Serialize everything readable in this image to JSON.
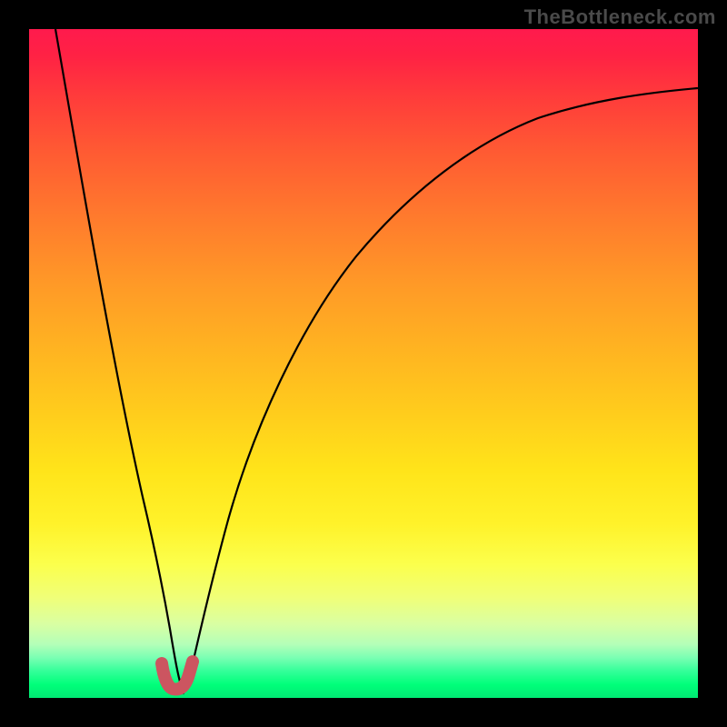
{
  "watermark": "TheBottleneck.com",
  "chart_data": {
    "type": "line",
    "title": "",
    "xlabel": "",
    "ylabel": "",
    "xlim": [
      0,
      100
    ],
    "ylim": [
      0,
      100
    ],
    "series": [
      {
        "name": "curve",
        "x": [
          4,
          6,
          8,
          10,
          12,
          14,
          16,
          17,
          18,
          19,
          20,
          21,
          22,
          23,
          24,
          25,
          27,
          30,
          35,
          40,
          45,
          50,
          55,
          60,
          65,
          70,
          75,
          80,
          85,
          90,
          95,
          100
        ],
        "values": [
          100,
          87,
          75,
          63,
          50,
          37,
          24,
          17,
          10,
          5,
          2,
          0.5,
          0.3,
          0.5,
          2,
          5,
          12,
          22,
          35,
          46,
          55,
          62,
          68,
          73,
          77,
          80,
          82.5,
          84.5,
          86,
          87,
          87.8,
          88.5
        ]
      },
      {
        "name": "highlight",
        "x": [
          19.5,
          20,
          20.5,
          21,
          21.5,
          22,
          22.5,
          23,
          23.5
        ],
        "values": [
          4,
          2,
          1,
          0.5,
          0.5,
          1,
          2,
          3.5,
          5
        ]
      }
    ],
    "gradient_stops": [
      {
        "pos": 0,
        "color": "#ff1a4d"
      },
      {
        "pos": 50,
        "color": "#ffce1c"
      },
      {
        "pos": 100,
        "color": "#00e873"
      }
    ]
  }
}
